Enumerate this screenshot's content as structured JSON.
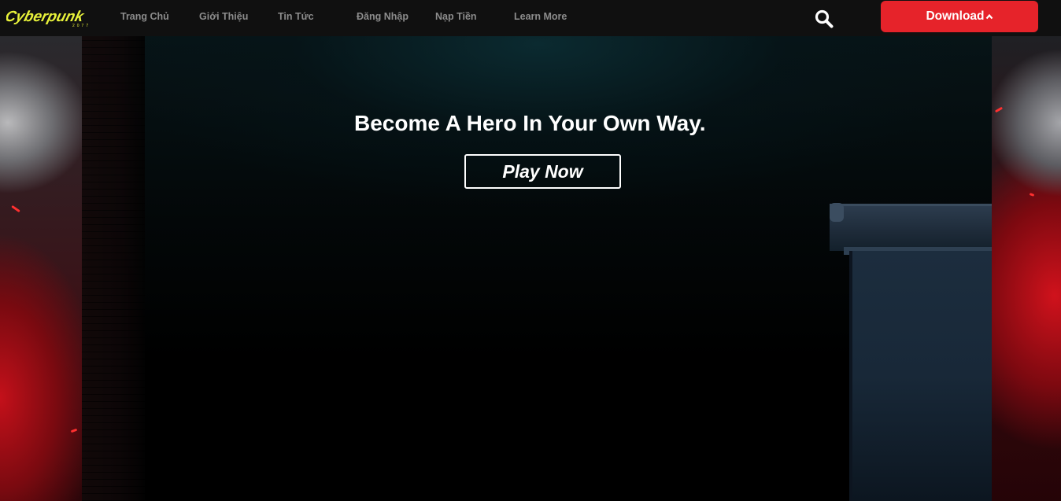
{
  "logo": {
    "text": "Cyberpunk",
    "subtext": "2077"
  },
  "nav": {
    "items": [
      {
        "label": "Trang Chủ"
      },
      {
        "label": "Giới Thiệu"
      },
      {
        "label": "Tin Tức"
      },
      {
        "label": "Đăng Nhập"
      },
      {
        "label": "Nạp Tiền"
      },
      {
        "label": "Learn More"
      }
    ]
  },
  "search": {
    "icon": "search-icon"
  },
  "download": {
    "label": "Download",
    "icon": "chevron-up-icon",
    "color": "#e6232a"
  },
  "hero": {
    "title": "Become A Hero In Your Own Way.",
    "cta_label": "Play Now"
  },
  "colors": {
    "navbar": "#101010",
    "nav_text": "#8c8c8c",
    "logo": "#e8f23a",
    "accent": "#e6232a"
  }
}
